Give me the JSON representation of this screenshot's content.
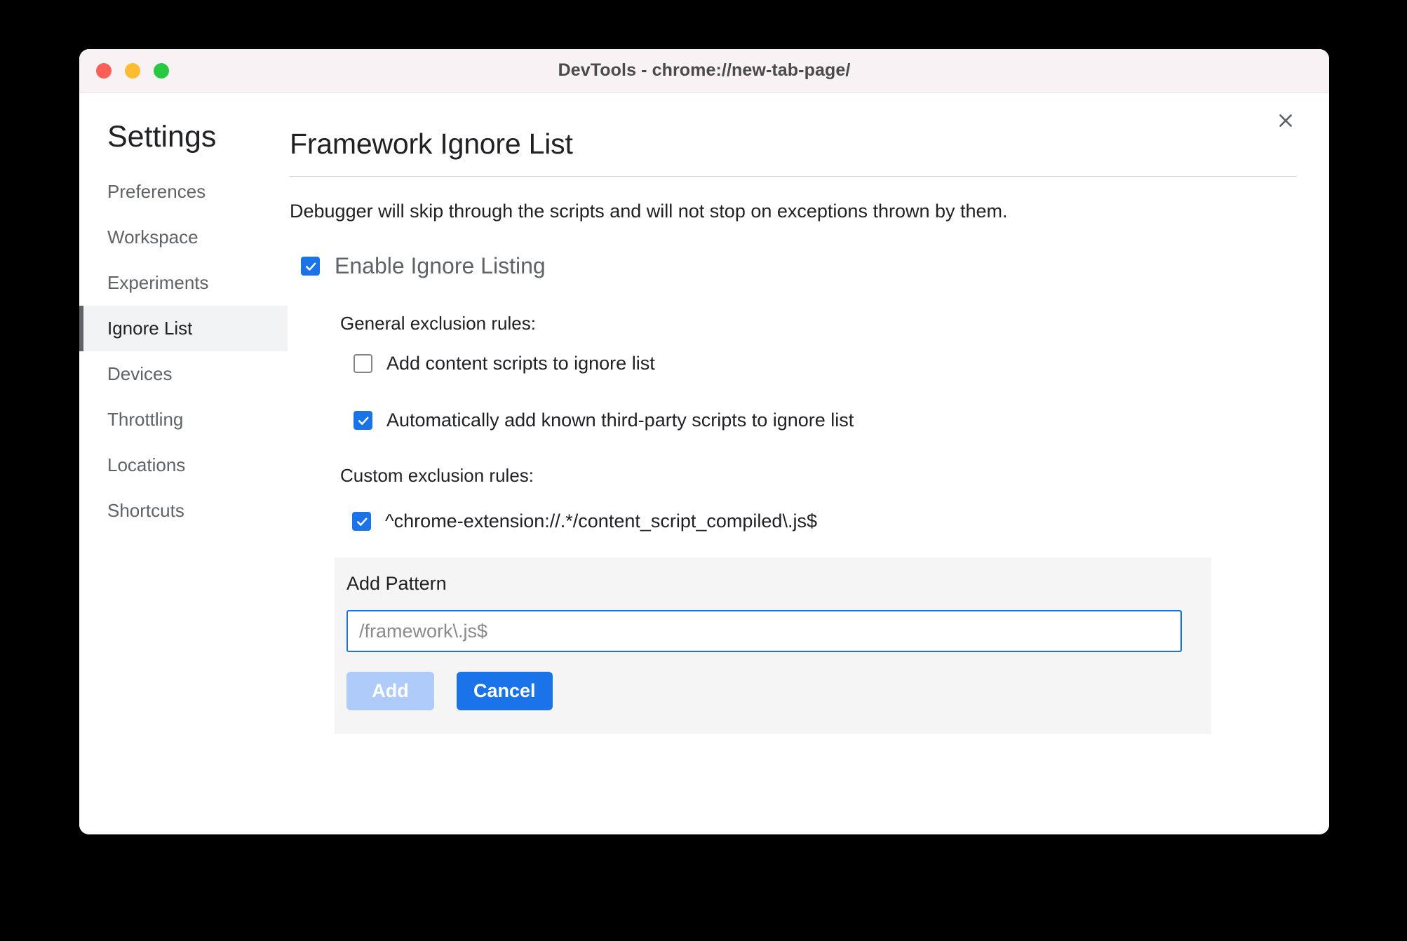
{
  "window": {
    "title": "DevTools - chrome://new-tab-page/",
    "traffic_lights": {
      "close": "close-window",
      "minimize": "minimize-window",
      "zoom": "zoom-window"
    }
  },
  "sidebar": {
    "title": "Settings",
    "items": [
      {
        "label": "Preferences",
        "selected": false
      },
      {
        "label": "Workspace",
        "selected": false
      },
      {
        "label": "Experiments",
        "selected": false
      },
      {
        "label": "Ignore List",
        "selected": true
      },
      {
        "label": "Devices",
        "selected": false
      },
      {
        "label": "Throttling",
        "selected": false
      },
      {
        "label": "Locations",
        "selected": false
      },
      {
        "label": "Shortcuts",
        "selected": false
      }
    ]
  },
  "main": {
    "close_icon": "close-icon",
    "page_title": "Framework Ignore List",
    "description": "Debugger will skip through the scripts and will not stop on exceptions thrown by them.",
    "enable": {
      "label": "Enable Ignore Listing",
      "checked": true
    },
    "general_section": {
      "title": "General exclusion rules:",
      "options": [
        {
          "label": "Add content scripts to ignore list",
          "checked": false
        },
        {
          "label": "Automatically add known third-party scripts to ignore list",
          "checked": true
        }
      ]
    },
    "custom_section": {
      "title": "Custom exclusion rules:",
      "patterns": [
        {
          "label": "^chrome-extension://.*/content_script_compiled\\.js$",
          "checked": true
        }
      ]
    },
    "add_pattern": {
      "title": "Add Pattern",
      "input_value": "",
      "input_placeholder": "/framework\\.js$",
      "add_label": "Add",
      "add_disabled": true,
      "cancel_label": "Cancel"
    }
  },
  "colors": {
    "accent": "#1a73e8",
    "accent_disabled": "#aecbfa",
    "selected_bg": "#f1f3f4",
    "panel_bg": "#f5f5f5",
    "titlebar_bg": "#f8f2f4",
    "traffic_red": "#ff5f57",
    "traffic_yellow": "#febc2e",
    "traffic_green": "#28c840"
  }
}
